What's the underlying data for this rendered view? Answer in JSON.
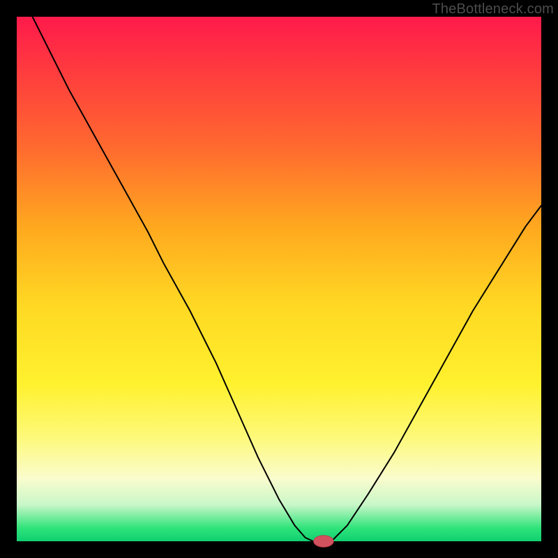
{
  "watermark": "TheBottleneck.com",
  "colors": {
    "frame": "#000000",
    "curve_stroke": "#000000",
    "marker_fill": "#d1525e",
    "marker_stroke": "#c0394d",
    "gradient_top": "#ff1a4b",
    "gradient_bottom": "#0fd070"
  },
  "chart_data": {
    "type": "line",
    "title": "",
    "xlabel": "",
    "ylabel": "",
    "xlim": [
      0,
      100
    ],
    "ylim": [
      0,
      100
    ],
    "series": [
      {
        "name": "left-branch",
        "x": [
          3,
          6,
          10,
          15,
          20,
          25,
          28,
          33,
          38,
          42,
          46,
          50,
          53,
          55,
          56.5
        ],
        "y": [
          100,
          94,
          86,
          77,
          68,
          59,
          53,
          44,
          34,
          25,
          16,
          8,
          3,
          0.7,
          0
        ]
      },
      {
        "name": "floor",
        "x": [
          56.5,
          60
        ],
        "y": [
          0,
          0
        ]
      },
      {
        "name": "right-branch",
        "x": [
          60,
          63,
          67,
          72,
          77,
          82,
          87,
          92,
          97,
          100
        ],
        "y": [
          0,
          3,
          9,
          17,
          26,
          35,
          44,
          52,
          60,
          64
        ]
      }
    ],
    "marker": {
      "x": 58.5,
      "y": 0,
      "rx": 1.9,
      "ry": 1.1
    },
    "grid": false,
    "legend": false
  }
}
